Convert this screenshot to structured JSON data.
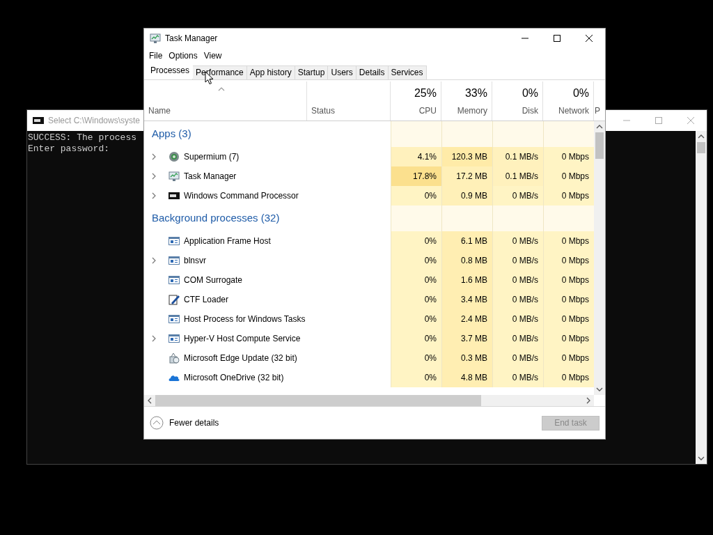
{
  "console_window": {
    "title": "Select C:\\Windows\\syste",
    "lines": [
      "SUCCESS: The process",
      "Enter password:"
    ]
  },
  "task_manager": {
    "title": "Task Manager",
    "menu": [
      "File",
      "Options",
      "View"
    ],
    "tabs": [
      {
        "label": "Processes",
        "selected": true
      },
      {
        "label": "Performance",
        "selected": false
      },
      {
        "label": "App history",
        "selected": false
      },
      {
        "label": "Startup",
        "selected": false
      },
      {
        "label": "Users",
        "selected": false
      },
      {
        "label": "Details",
        "selected": false
      },
      {
        "label": "Services",
        "selected": false
      }
    ],
    "columns": [
      {
        "label": "Name",
        "kind": "name",
        "sorted": true
      },
      {
        "label": "Status",
        "kind": "text",
        "sorted": false
      },
      {
        "label": "CPU",
        "kind": "metric",
        "total": "25%",
        "sorted": false
      },
      {
        "label": "Memory",
        "kind": "metric",
        "total": "33%",
        "sorted": false
      },
      {
        "label": "Disk",
        "kind": "metric",
        "total": "0%",
        "sorted": false
      },
      {
        "label": "Network",
        "kind": "metric",
        "total": "0%",
        "sorted": false
      },
      {
        "label": "P",
        "kind": "cut",
        "sorted": false
      }
    ],
    "groups": [
      {
        "title": "Apps (3)",
        "rows": [
          {
            "name": "Supermium (7)",
            "kind": "globe",
            "expandable": true,
            "cells": [
              {
                "text": "4.1%",
                "color": "#fff1bd"
              },
              {
                "text": "120.3 MB",
                "color": "#ffeba8"
              },
              {
                "text": "0.1 MB/s",
                "color": "#fff1bd"
              },
              {
                "text": "0 Mbps",
                "color": "#fff4c4"
              }
            ]
          },
          {
            "name": "Task Manager",
            "kind": "monitor",
            "expandable": true,
            "cells": [
              {
                "text": "17.8%",
                "color": "#fbe08e"
              },
              {
                "text": "17.2 MB",
                "color": "#fff0b8"
              },
              {
                "text": "0.1 MB/s",
                "color": "#fff1bd"
              },
              {
                "text": "0 Mbps",
                "color": "#fff4c4"
              }
            ]
          },
          {
            "name": "Windows Command Processor",
            "kind": "console",
            "expandable": true,
            "cells": [
              {
                "text": "0%",
                "color": "#fff4c4"
              },
              {
                "text": "0.9 MB",
                "color": "#fff0b8"
              },
              {
                "text": "0 MB/s",
                "color": "#fff4c4"
              },
              {
                "text": "0 Mbps",
                "color": "#fff4c4"
              }
            ]
          }
        ]
      },
      {
        "title": "Background processes (32)",
        "rows": [
          {
            "name": "Application Frame Host",
            "kind": "window",
            "expandable": false,
            "cells": [
              {
                "text": "0%",
                "color": "#fff4c4"
              },
              {
                "text": "6.1 MB",
                "color": "#ffeeb2"
              },
              {
                "text": "0 MB/s",
                "color": "#fff4c4"
              },
              {
                "text": "0 Mbps",
                "color": "#fff4c4"
              }
            ]
          },
          {
            "name": "blnsvr",
            "kind": "window",
            "expandable": true,
            "cells": [
              {
                "text": "0%",
                "color": "#fff4c4"
              },
              {
                "text": "0.8 MB",
                "color": "#ffeeb2"
              },
              {
                "text": "0 MB/s",
                "color": "#fff4c4"
              },
              {
                "text": "0 Mbps",
                "color": "#fff4c4"
              }
            ]
          },
          {
            "name": "COM Surrogate",
            "kind": "window",
            "expandable": false,
            "cells": [
              {
                "text": "0%",
                "color": "#fff4c4"
              },
              {
                "text": "1.6 MB",
                "color": "#ffeeb2"
              },
              {
                "text": "0 MB/s",
                "color": "#fff4c4"
              },
              {
                "text": "0 Mbps",
                "color": "#fff4c4"
              }
            ]
          },
          {
            "name": "CTF Loader",
            "kind": "pen",
            "expandable": false,
            "cells": [
              {
                "text": "0%",
                "color": "#fff4c4"
              },
              {
                "text": "3.4 MB",
                "color": "#ffeeb2"
              },
              {
                "text": "0 MB/s",
                "color": "#fff4c4"
              },
              {
                "text": "0 Mbps",
                "color": "#fff4c4"
              }
            ]
          },
          {
            "name": "Host Process for Windows Tasks",
            "kind": "window",
            "expandable": false,
            "cells": [
              {
                "text": "0%",
                "color": "#fff4c4"
              },
              {
                "text": "2.4 MB",
                "color": "#ffeeb2"
              },
              {
                "text": "0 MB/s",
                "color": "#fff4c4"
              },
              {
                "text": "0 Mbps",
                "color": "#fff4c4"
              }
            ]
          },
          {
            "name": "Hyper-V Host Compute Service",
            "kind": "window",
            "expandable": true,
            "cells": [
              {
                "text": "0%",
                "color": "#fff4c4"
              },
              {
                "text": "3.7 MB",
                "color": "#ffeeb2"
              },
              {
                "text": "0 MB/s",
                "color": "#fff4c4"
              },
              {
                "text": "0 Mbps",
                "color": "#fff4c4"
              }
            ]
          },
          {
            "name": "Microsoft Edge Update (32 bit)",
            "kind": "package",
            "expandable": false,
            "cells": [
              {
                "text": "0%",
                "color": "#fff4c4"
              },
              {
                "text": "0.3 MB",
                "color": "#ffeeb2"
              },
              {
                "text": "0 MB/s",
                "color": "#fff4c4"
              },
              {
                "text": "0 Mbps",
                "color": "#fff4c4"
              }
            ]
          },
          {
            "name": "Microsoft OneDrive (32 bit)",
            "kind": "cloud",
            "expandable": false,
            "cells": [
              {
                "text": "0%",
                "color": "#fff4c4"
              },
              {
                "text": "4.8 MB",
                "color": "#ffeeb2"
              },
              {
                "text": "0 MB/s",
                "color": "#fff4c4"
              },
              {
                "text": "0 Mbps",
                "color": "#fff4c4"
              }
            ]
          }
        ]
      }
    ],
    "footer": {
      "details_link": "Fewer details",
      "end_button": {
        "label": "End task",
        "disabled": true
      }
    }
  }
}
